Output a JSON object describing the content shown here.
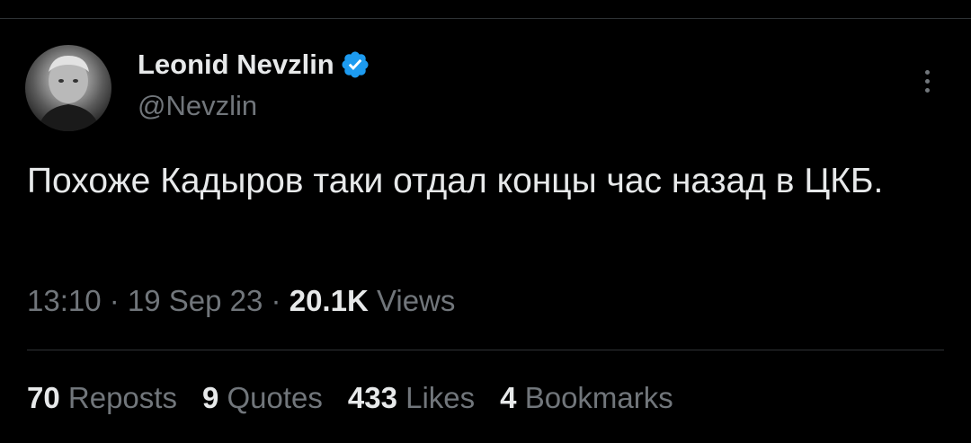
{
  "author": {
    "display_name": "Leonid Nevzlin",
    "handle": "@Nevzlin",
    "verified_color": "#1d9bf0",
    "avatar_icon": "avatar-photo"
  },
  "tweet": {
    "text": "Похоже Кадыров таки отдал концы час назад в ЦКБ."
  },
  "meta": {
    "time": "13:10",
    "sep1": " · ",
    "date": "19 Sep 23",
    "sep2": " · ",
    "views_count": "20.1K",
    "views_label": " Views"
  },
  "stats": [
    {
      "count": "70",
      "label": "Reposts"
    },
    {
      "count": "9",
      "label": "Quotes"
    },
    {
      "count": "433",
      "label": "Likes"
    },
    {
      "count": "4",
      "label": "Bookmarks"
    }
  ],
  "colors": {
    "background": "#000000",
    "text": "#e7e9ea",
    "secondary": "#71767b",
    "divider": "#2f3336"
  }
}
